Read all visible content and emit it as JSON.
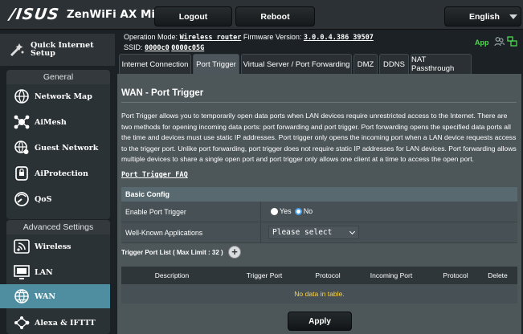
{
  "header": {
    "brand": "/ISUS",
    "model": "ZenWiFi AX Mini",
    "logout_label": "Logout",
    "reboot_label": "Reboot",
    "language": "English"
  },
  "status": {
    "operation_mode_label": "Operation Mode:",
    "operation_mode_value": "Wireless router",
    "firmware_label": "Firmware Version:",
    "firmware_value": "3.0.0.4.386_39507",
    "ssid_label": "SSID:",
    "ssid_1": "0000c0",
    "ssid_2": "0000c05G",
    "app_label": "App"
  },
  "sidebar": {
    "quick_setup": "Quick Internet Setup",
    "general_title": "General",
    "general_items": [
      {
        "label": "Network Map",
        "icon": "network-map-icon"
      },
      {
        "label": "AiMesh",
        "icon": "aimesh-icon"
      },
      {
        "label": "Guest Network",
        "icon": "guest-network-icon"
      },
      {
        "label": "AiProtection",
        "icon": "aiprotection-icon"
      },
      {
        "label": "QoS",
        "icon": "qos-icon"
      }
    ],
    "advanced_title": "Advanced Settings",
    "advanced_items": [
      {
        "label": "Wireless",
        "icon": "wireless-icon"
      },
      {
        "label": "LAN",
        "icon": "lan-icon"
      },
      {
        "label": "WAN",
        "icon": "wan-icon",
        "active": true
      },
      {
        "label": "Alexa & IFTTT",
        "icon": "alexa-icon"
      }
    ]
  },
  "tabs": [
    {
      "label": "Internet Connection",
      "active": false
    },
    {
      "label": "Port Trigger",
      "active": true
    },
    {
      "label": "Virtual Server / Port Forwarding",
      "active": false
    },
    {
      "label": "DMZ",
      "active": false
    },
    {
      "label": "DDNS",
      "active": false
    },
    {
      "label": "NAT Passthrough",
      "active": false
    }
  ],
  "page": {
    "title": "WAN - Port Trigger",
    "description": "Port Trigger allows you to temporarily open data ports when LAN devices require unrestricted access to the Internet. There are two methods for opening incoming data ports: port forwarding and port trigger. Port forwarding opens the specified data ports all the time and devices must use static IP addresses. Port trigger only opens the incoming port when a LAN device requests access to the trigger port. Unlike port forwarding, port trigger does not require static IP addresses for LAN devices. Port forwarding allows multiple devices to share a single open port and port trigger only allows one client at a time to access the open port.",
    "faq_link": "Port Trigger FAQ",
    "basic_config": "Basic Config",
    "enable_label": "Enable Port Trigger",
    "radio_yes": "Yes",
    "radio_no": "No",
    "enable_value": "No",
    "wellknown_label": "Well-Known Applications",
    "wellknown_value": "Please select",
    "list_title": "Trigger Port List ( Max Limit : 32 )",
    "columns": [
      "Description",
      "Trigger Port",
      "Protocol",
      "Incoming Port",
      "Protocol",
      "Delete"
    ],
    "empty_text": "No data in table.",
    "apply_label": "Apply"
  },
  "colors": {
    "accent_active": "#4e8ea0",
    "empty_text": "#ffd33a",
    "app_green": "#4fd84f",
    "radio_blue": "#4a9fe8"
  }
}
